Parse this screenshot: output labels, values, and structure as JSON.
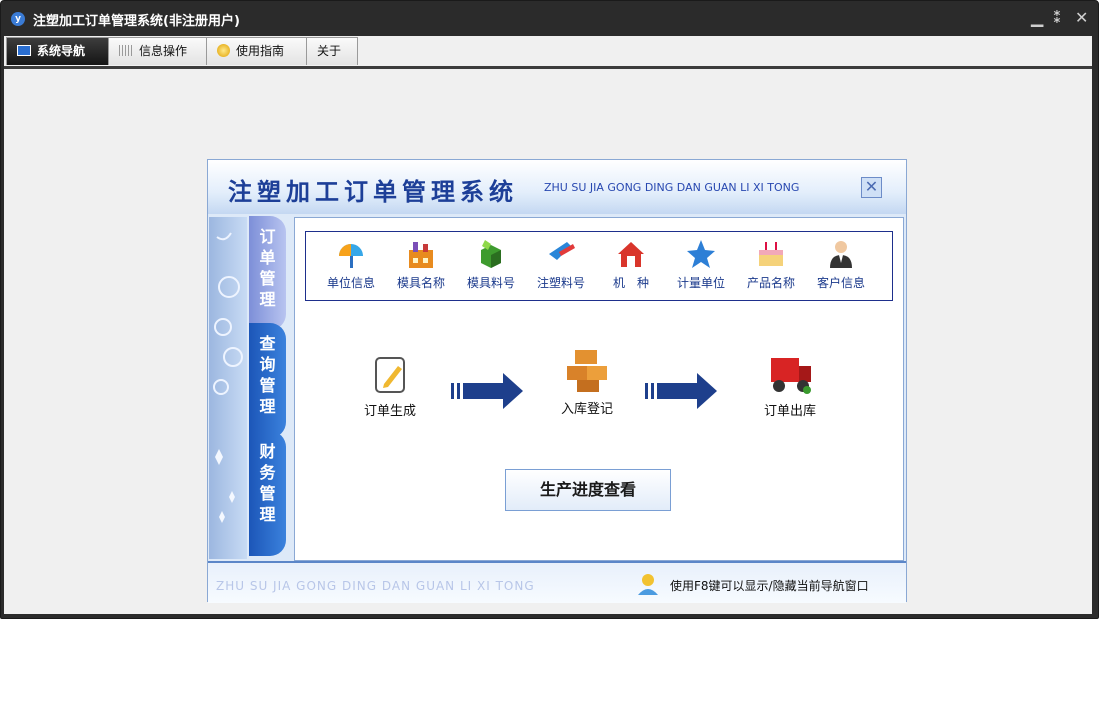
{
  "window": {
    "title": "注塑加工订单管理系统(非注册用户)",
    "controls": {
      "minimize": "▁",
      "restore": "⁑",
      "close": "✕"
    }
  },
  "tabs": [
    {
      "label": "系统导航",
      "icon": "monitor-icon",
      "active": true
    },
    {
      "label": "信息操作",
      "icon": "grid-icon",
      "active": false
    },
    {
      "label": "使用指南",
      "icon": "help-icon",
      "active": false
    },
    {
      "label": "关于",
      "icon": "",
      "active": false
    }
  ],
  "nav": {
    "title": "注塑加工订单管理系统",
    "pinyin": "ZHU SU JIA GONG DING DAN GUAN LI XI TONG",
    "side_tabs": [
      "订单管理",
      "查询管理",
      "财务管理"
    ],
    "quick_items": [
      {
        "label": "单位信息",
        "icon": "umbrella-icon"
      },
      {
        "label": "模具名称",
        "icon": "factory-icon"
      },
      {
        "label": "模具料号",
        "icon": "box-icon"
      },
      {
        "label": "注塑料号",
        "icon": "pencil-icon"
      },
      {
        "label": "机　种",
        "icon": "house-icon"
      },
      {
        "label": "计量单位",
        "icon": "star-icon"
      },
      {
        "label": "产品名称",
        "icon": "cake-icon"
      },
      {
        "label": "客户信息",
        "icon": "person-icon"
      }
    ],
    "flow": [
      {
        "label": "订单生成",
        "icon": "notepad-icon"
      },
      {
        "label": "入库登记",
        "icon": "boxes-icon"
      },
      {
        "label": "订单出库",
        "icon": "truck-icon"
      }
    ],
    "progress_button": "生产进度查看",
    "footer_pinyin": "ZHU SU JIA GONG DING DAN GUAN LI XI TONG",
    "footer_hint": "使用F8键可以显示/隐藏当前导航窗口"
  },
  "colors": {
    "accent": "#1d3f98",
    "tab_active": "#1a1a1a",
    "nav_blue": "#2a6ed0"
  }
}
